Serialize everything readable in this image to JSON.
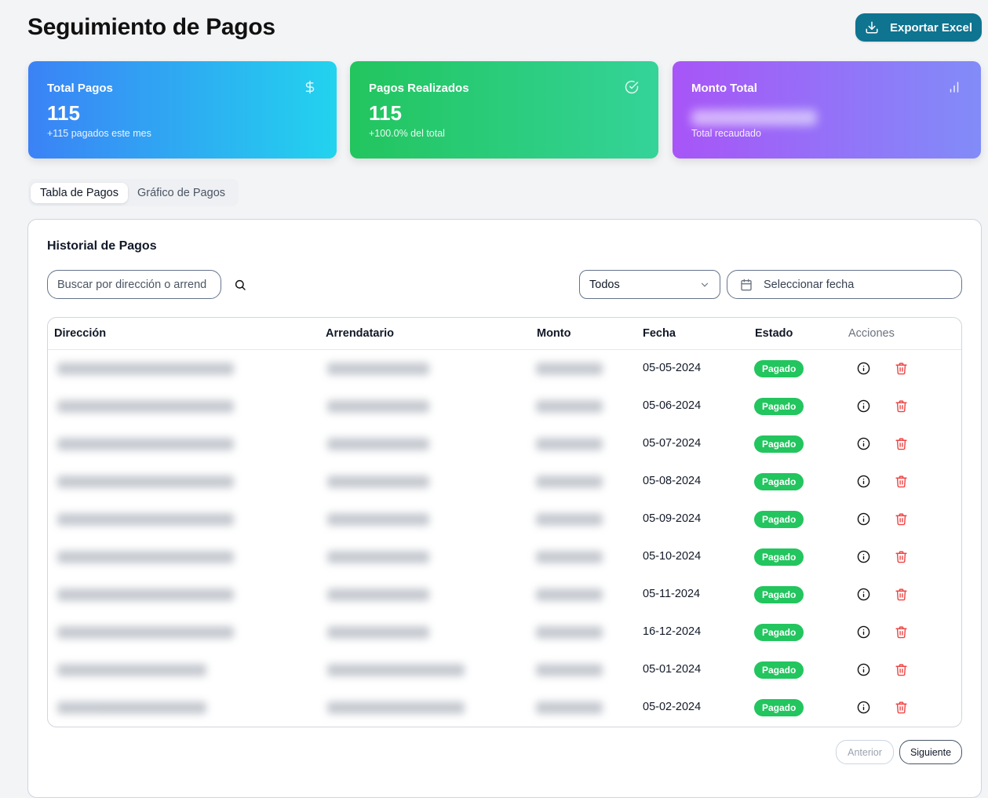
{
  "header": {
    "title": "Seguimiento de Pagos",
    "export_label": "Exportar Excel"
  },
  "cards": [
    {
      "title": "Total Pagos",
      "value": "115",
      "sub": "+115 pagados este mes",
      "icon": "dollar-icon"
    },
    {
      "title": "Pagos Realizados",
      "value": "115",
      "sub": "+100.0% del total",
      "icon": "check-circle-icon"
    },
    {
      "title": "Monto Total",
      "value": "",
      "sub": "Total recaudado",
      "icon": "bar-chart-icon"
    }
  ],
  "tabs": [
    {
      "label": "Tabla de Pagos",
      "active": true
    },
    {
      "label": "Gráfico de Pagos",
      "active": false
    }
  ],
  "panel": {
    "title": "Historial de Pagos",
    "search_placeholder": "Buscar por dirección o arrend",
    "filter_selected": "Todos",
    "date_placeholder": "Seleccionar fecha"
  },
  "table": {
    "columns": [
      "Dirección",
      "Arrendatario",
      "Monto",
      "Fecha",
      "Estado",
      "Acciones"
    ],
    "rows": [
      {
        "fecha": "05-05-2024",
        "estado": "Pagado"
      },
      {
        "fecha": "05-06-2024",
        "estado": "Pagado"
      },
      {
        "fecha": "05-07-2024",
        "estado": "Pagado"
      },
      {
        "fecha": "05-08-2024",
        "estado": "Pagado"
      },
      {
        "fecha": "05-09-2024",
        "estado": "Pagado"
      },
      {
        "fecha": "05-10-2024",
        "estado": "Pagado"
      },
      {
        "fecha": "05-11-2024",
        "estado": "Pagado"
      },
      {
        "fecha": "16-12-2024",
        "estado": "Pagado"
      },
      {
        "fecha": "05-01-2024",
        "estado": "Pagado"
      },
      {
        "fecha": "05-02-2024",
        "estado": "Pagado"
      }
    ]
  },
  "pagination": {
    "prev_label": "Anterior",
    "next_label": "Siguiente"
  },
  "colors": {
    "accent": "#0e7490",
    "status_paid": "#22c55e",
    "delete": "#ef4444"
  }
}
